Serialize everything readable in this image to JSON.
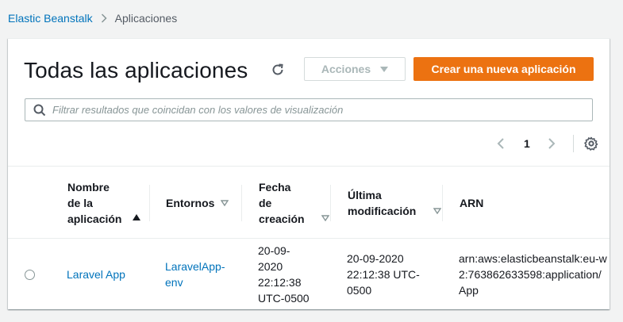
{
  "breadcrumb": {
    "root": "Elastic Beanstalk",
    "current": "Aplicaciones"
  },
  "header": {
    "title": "Todas las aplicaciones",
    "actions_label": "Acciones",
    "create_label": "Crear una nueva aplicación"
  },
  "search": {
    "placeholder": "Filtrar resultados que coincidan con los valores de visualización",
    "value": ""
  },
  "pagination": {
    "page": "1"
  },
  "table": {
    "columns": [
      {
        "label": "Nombre\nde la\naplicación",
        "sort": "asc"
      },
      {
        "label": "Entornos",
        "sort": "none"
      },
      {
        "label": "Fecha\nde\ncreación",
        "sort": "none"
      },
      {
        "label": "Última\nmodificación",
        "sort": "none"
      },
      {
        "label": "ARN",
        "sort": ""
      }
    ],
    "rows": [
      {
        "name": "Laravel App",
        "environments": "LaravelApp-\nenv",
        "created": "20-09-\n2020\n22:12:38\nUTC-0500",
        "modified": "20-09-2020\n22:12:38 UTC-\n0500",
        "arn": "arn:aws:elasticbeanstalk:eu-w\n2:763862633598:application/\nApp"
      }
    ]
  },
  "colors": {
    "accent_orange": "#ec7211",
    "link_blue": "#0073bb"
  }
}
